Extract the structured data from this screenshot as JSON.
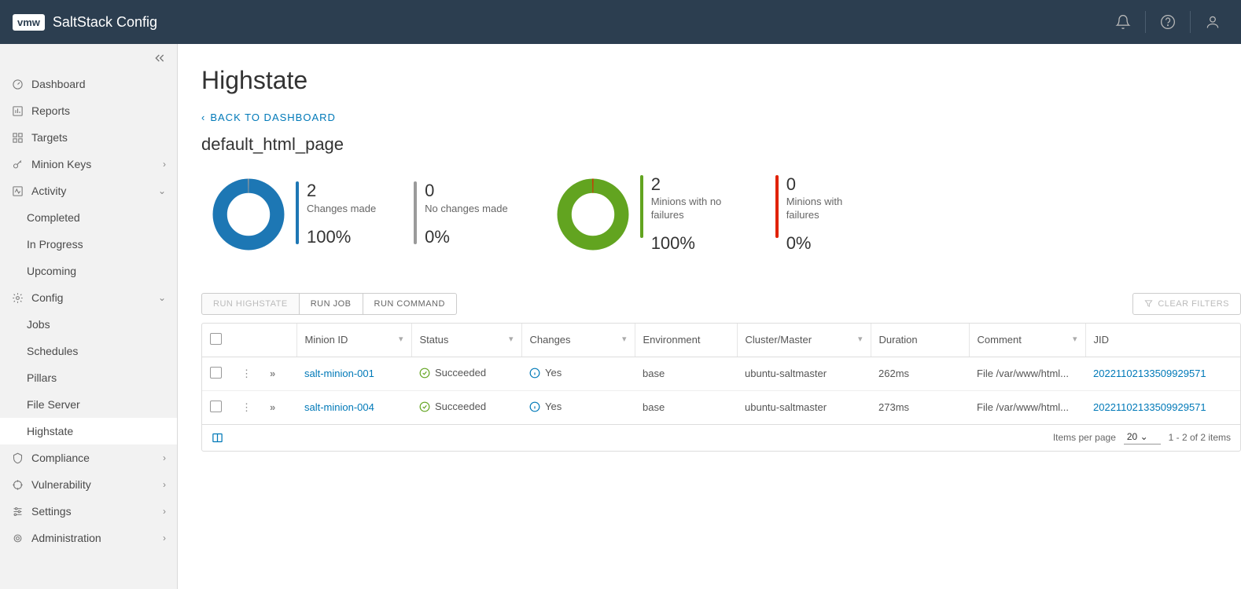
{
  "app": {
    "logo": "vmw",
    "title": "SaltStack Config"
  },
  "sidebar": {
    "items": [
      {
        "label": "Dashboard"
      },
      {
        "label": "Reports"
      },
      {
        "label": "Targets"
      },
      {
        "label": "Minion Keys"
      },
      {
        "label": "Activity"
      },
      {
        "label": "Completed"
      },
      {
        "label": "In Progress"
      },
      {
        "label": "Upcoming"
      },
      {
        "label": "Config"
      },
      {
        "label": "Jobs"
      },
      {
        "label": "Schedules"
      },
      {
        "label": "Pillars"
      },
      {
        "label": "File Server"
      },
      {
        "label": "Highstate"
      },
      {
        "label": "Compliance"
      },
      {
        "label": "Vulnerability"
      },
      {
        "label": "Settings"
      },
      {
        "label": "Administration"
      }
    ]
  },
  "page": {
    "title": "Highstate",
    "back": "BACK TO DASHBOARD",
    "state_name": "default_html_page"
  },
  "chart_data": [
    {
      "type": "pie",
      "title": "Changes",
      "series": [
        {
          "name": "Changes made",
          "value": 2,
          "pct": "100%",
          "color": "#1d77b4"
        },
        {
          "name": "No changes made",
          "value": 0,
          "pct": "0%",
          "color": "#9a9a9a"
        }
      ]
    },
    {
      "type": "pie",
      "title": "Minion failures",
      "series": [
        {
          "name": "Minions with no failures",
          "value": 2,
          "pct": "100%",
          "color": "#62a420"
        },
        {
          "name": "Minions with failures",
          "value": 0,
          "pct": "0%",
          "color": "#e12200"
        }
      ]
    }
  ],
  "actions": {
    "run_highstate": "RUN HIGHSTATE",
    "run_job": "RUN JOB",
    "run_command": "RUN COMMAND",
    "clear_filters": "CLEAR FILTERS"
  },
  "table": {
    "columns": [
      "Minion ID",
      "Status",
      "Changes",
      "Environment",
      "Cluster/Master",
      "Duration",
      "Comment",
      "JID"
    ],
    "rows": [
      {
        "minion": "salt-minion-001",
        "status": "Succeeded",
        "changes": "Yes",
        "env": "base",
        "master": "ubuntu-saltmaster",
        "duration": "262ms",
        "comment": "File /var/www/html...",
        "jid": "20221102133509929571"
      },
      {
        "minion": "salt-minion-004",
        "status": "Succeeded",
        "changes": "Yes",
        "env": "base",
        "master": "ubuntu-saltmaster",
        "duration": "273ms",
        "comment": "File /var/www/html...",
        "jid": "20221102133509929571"
      }
    ],
    "footer": {
      "ipp_label": "Items per page",
      "ipp_value": "20",
      "range": "1 - 2 of 2 items"
    }
  }
}
